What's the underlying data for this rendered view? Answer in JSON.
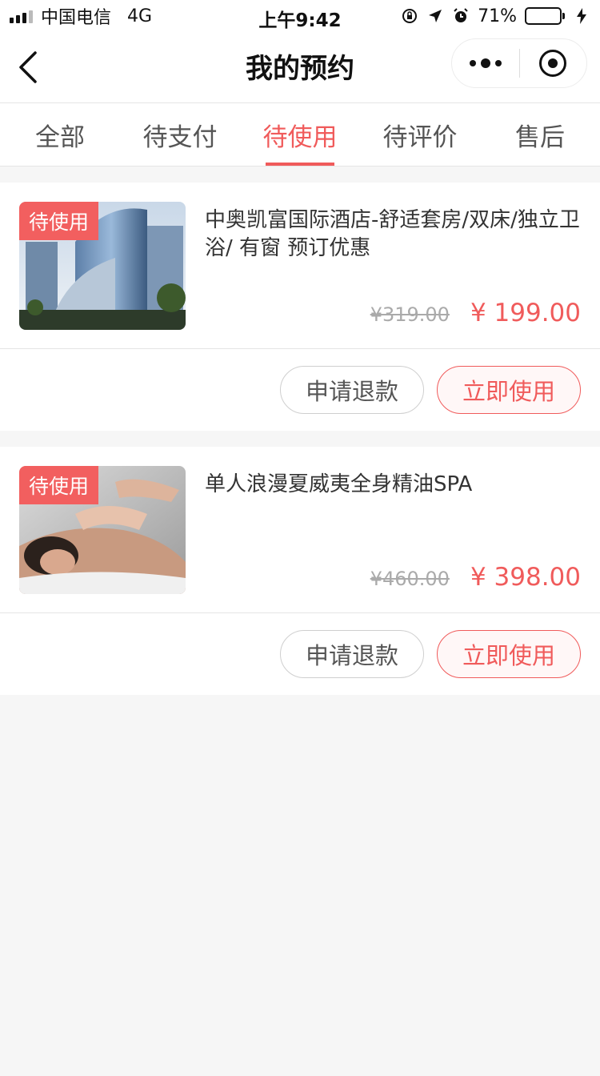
{
  "status_bar": {
    "carrier": "中国电信",
    "network": "4G",
    "time": "上午9:42",
    "battery_text": "71%",
    "battery_level": 0.71,
    "battery_color": "#4cd964"
  },
  "nav": {
    "title": "我的预约",
    "back_icon": "chevron-left-icon",
    "more_icon": "more-dots-icon",
    "close_icon": "target-circle-icon"
  },
  "tabs": [
    {
      "label": "全部",
      "active": false
    },
    {
      "label": "待支付",
      "active": false
    },
    {
      "label": "待使用",
      "active": true
    },
    {
      "label": "待评价",
      "active": false
    },
    {
      "label": "售后",
      "active": false
    }
  ],
  "accent_color": "#f05b5b",
  "orders": [
    {
      "badge": "待使用",
      "title": "中奥凯富国际酒店-舒适套房/双床/独立卫浴/ 有窗  预订优惠",
      "original_price": "¥319.00",
      "price": "¥ 199.00",
      "refund_label": "申请退款",
      "use_label": "立即使用"
    },
    {
      "badge": "待使用",
      "title": "单人浪漫夏威夷全身精油SPA",
      "original_price": "¥460.00",
      "price": "¥ 398.00",
      "refund_label": "申请退款",
      "use_label": "立即使用"
    }
  ]
}
